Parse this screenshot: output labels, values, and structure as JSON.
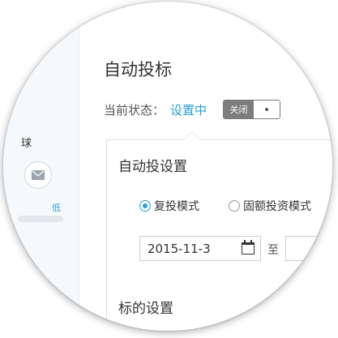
{
  "sidebar": {
    "text_fragment": "球",
    "mail_icon": "mail-icon",
    "low_label": "低"
  },
  "page": {
    "title": "自动投标",
    "status_label": "当前状态：",
    "status_value": "设置中",
    "toggle_label": "关闭"
  },
  "settings": {
    "title": "自动投设置",
    "radio_options": [
      {
        "label": "复投模式",
        "selected": true
      },
      {
        "label": "固额投资模式",
        "selected": false
      }
    ],
    "date_start": "2015-11-3",
    "date_separator": "至",
    "next_section_title": "标的设置"
  },
  "colors": {
    "accent": "#2a9fd6",
    "toggle_bg": "#7d7d7d"
  }
}
